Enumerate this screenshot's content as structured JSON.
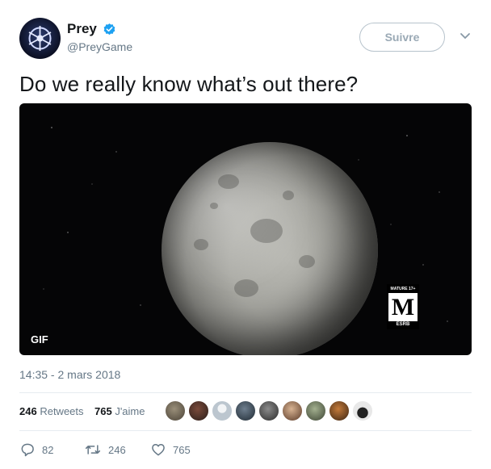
{
  "tweet": {
    "user": {
      "display_name": "Prey",
      "handle": "@PreyGame",
      "verified": true
    },
    "follow_label": "Suivre",
    "text": "Do we really know what’s out there?",
    "media": {
      "gif_label": "GIF",
      "rating": {
        "top": "MATURE 17+",
        "letter": "M",
        "bottom": "ESRB"
      }
    },
    "timestamp": "14:35 - 2 mars 2018",
    "stats": {
      "retweets_count": "246",
      "retweets_label": "Retweets",
      "likes_count": "765",
      "likes_label": "J'aime"
    },
    "actions": {
      "reply_count": "82",
      "retweet_count": "246",
      "like_count": "765"
    }
  },
  "colors": {
    "text": "#14171a",
    "secondary": "#657786",
    "verified": "#1da1f2",
    "border": "#e6ecf0"
  }
}
